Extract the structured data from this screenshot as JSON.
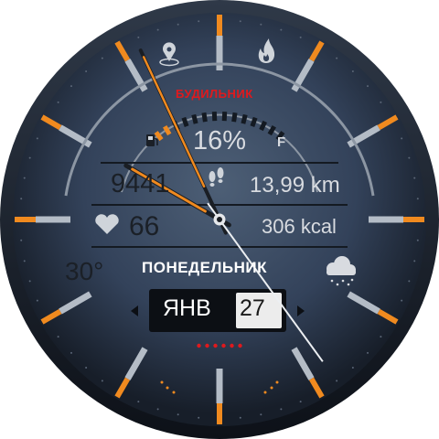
{
  "alarm_label": "БУДИЛЬНИК",
  "fuel": {
    "value": "16%",
    "full_marker": "F",
    "level_fraction": 0.16
  },
  "steps": "9441",
  "distance": "13,99 km",
  "heart_rate": "66",
  "calories": "306 kcal",
  "temperature": "30°",
  "weekday": "ПОНЕДЕЛЬНИК",
  "month": "ЯНВ",
  "date": "27",
  "icons": {
    "top_left": "location-pin-icon",
    "top_right": "flame-icon",
    "fuel": "fuel-pump-icon",
    "steps": "footsteps-icon",
    "heart": "heart-icon",
    "weather": "snow-cloud-icon",
    "prev": "chevron-left-icon",
    "next": "chevron-right-icon"
  },
  "clock": {
    "hour_hand_deg": 300,
    "minute_hand_deg": 335,
    "second_hand_deg": 144
  },
  "colors": {
    "accent": "#f08a1f",
    "alarm": "#e0191d",
    "dial_center": "#4d5f76",
    "dial_edge": "#171e29",
    "text_light": "#d8dbe0",
    "text_dark": "#1b2027"
  },
  "page_dots": 6
}
